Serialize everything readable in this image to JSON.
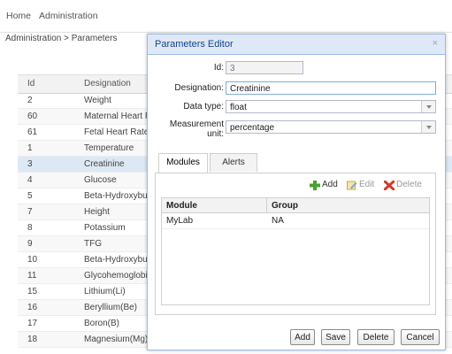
{
  "nav": {
    "home": "Home",
    "admin": "Administration"
  },
  "breadcrumb": "Administration > Parameters",
  "grid": {
    "columns": {
      "id": "Id",
      "designation": "Designation"
    },
    "rows": [
      {
        "id": "2",
        "name": "Weight"
      },
      {
        "id": "60",
        "name": "Maternal Heart R"
      },
      {
        "id": "61",
        "name": "Fetal Heart Rate"
      },
      {
        "id": "1",
        "name": "Temperature"
      },
      {
        "id": "3",
        "name": "Creatinine"
      },
      {
        "id": "4",
        "name": "Glucose"
      },
      {
        "id": "5",
        "name": "Beta-Hydroxybuty"
      },
      {
        "id": "7",
        "name": "Height"
      },
      {
        "id": "8",
        "name": "Potassium"
      },
      {
        "id": "9",
        "name": "TFG"
      },
      {
        "id": "10",
        "name": "Beta-Hydroxybuty"
      },
      {
        "id": "11",
        "name": "Glycohemoglobin"
      },
      {
        "id": "15",
        "name": "Lithium(Li)"
      },
      {
        "id": "16",
        "name": "Beryllium(Be)"
      },
      {
        "id": "17",
        "name": "Boron(B)"
      },
      {
        "id": "18",
        "name": "Magnesium(Mg)"
      }
    ]
  },
  "dialog": {
    "title": "Parameters Editor",
    "close": "×",
    "fields": {
      "id": {
        "label": "Id:",
        "value": "3"
      },
      "designation": {
        "label": "Designation:",
        "value": "Creatinine"
      },
      "data_type": {
        "label": "Data type:",
        "value": "float"
      },
      "unit": {
        "label_1": "Measurement",
        "label_2": "unit:",
        "value": "percentage"
      }
    },
    "tabs": {
      "modules": "Modules",
      "alerts": "Alerts"
    },
    "toolbar": {
      "add": "Add",
      "edit": "Edit",
      "delete": "Delete"
    },
    "modules_grid": {
      "columns": {
        "module": "Module",
        "group": "Group"
      },
      "rows": [
        {
          "module": "MyLab",
          "group": "NA"
        }
      ]
    },
    "buttons": {
      "add": "Add",
      "save": "Save",
      "delete": "Delete",
      "cancel": "Cancel"
    }
  },
  "colors": {
    "accent": "#15428b",
    "dialog_border": "#99bbe8",
    "selected_row": "#dde8f5"
  },
  "icons": {
    "add": "plus-icon",
    "edit": "edit-icon",
    "delete": "delete-icon"
  }
}
